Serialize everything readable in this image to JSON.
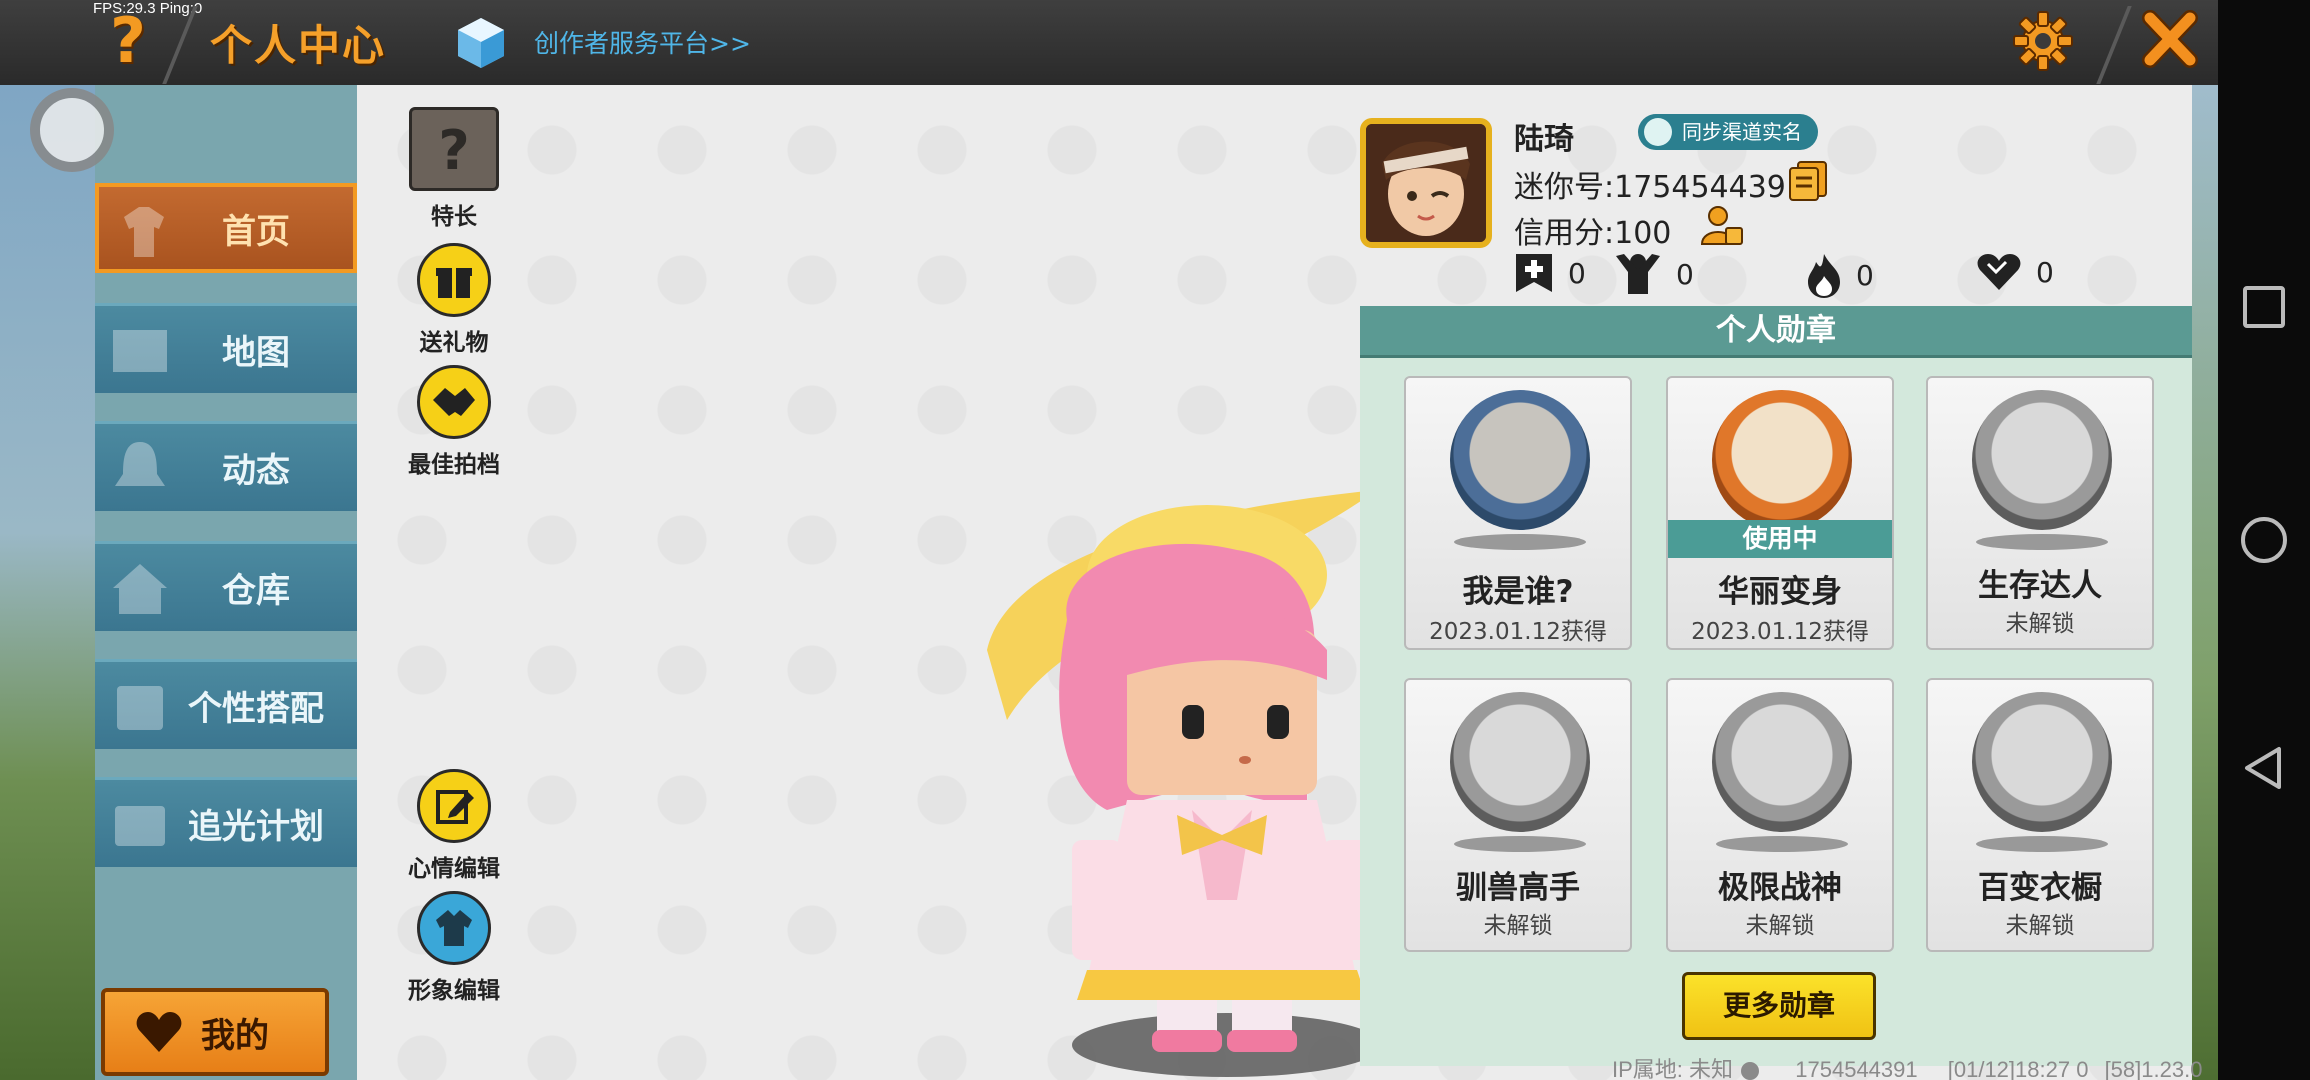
{
  "top_bar": {
    "fps": "FPS:29.3  Ping:0",
    "title": "个人中心",
    "creator_link": "创作者服务平台>>"
  },
  "sidebar": {
    "items": [
      {
        "label": "首页",
        "active": true
      },
      {
        "label": "地图"
      },
      {
        "label": "动态"
      },
      {
        "label": "仓库"
      },
      {
        "label": "个性搭配"
      },
      {
        "label": "追光计划"
      }
    ],
    "mine_label": "我的"
  },
  "tools": [
    {
      "label": "特长",
      "icon": "question-box-icon"
    },
    {
      "label": "送礼物",
      "icon": "gift-icon"
    },
    {
      "label": "最佳拍档",
      "icon": "handshake-icon"
    },
    {
      "label": "心情编辑",
      "icon": "edit-icon"
    },
    {
      "label": "形象编辑",
      "icon": "outfit-icon"
    }
  ],
  "profile": {
    "nickname": "陆琦",
    "sync_badge": "同步渠道实名",
    "mini_id": "迷你号:1754544391",
    "credit": "信用分:100",
    "stats": [
      {
        "icon": "add-friend-icon",
        "value": "0"
      },
      {
        "icon": "fans-icon",
        "value": "0"
      },
      {
        "icon": "fire-icon",
        "value": "0"
      },
      {
        "icon": "likes-icon",
        "value": "0"
      }
    ]
  },
  "medals": {
    "header": "个人勋章",
    "items": [
      {
        "name": "我是谁?",
        "sub": "2023.01.12获得",
        "style": "blue"
      },
      {
        "name": "华丽变身",
        "sub": "2023.01.12获得",
        "style": "orange",
        "badge": "使用中"
      },
      {
        "name": "生存达人",
        "sub": "未解锁",
        "style": "gray"
      },
      {
        "name": "驯兽高手",
        "sub": "未解锁",
        "style": "gray"
      },
      {
        "name": "极限战神",
        "sub": "未解锁",
        "style": "gray"
      },
      {
        "name": "百变衣橱",
        "sub": "未解锁",
        "style": "gray"
      }
    ],
    "more_button": "更多勋章"
  },
  "footer": {
    "ip": "IP属地: 未知",
    "uid": "1754544391",
    "time": "[01/12]18:27 0",
    "version": "[58]1.23.0"
  },
  "colors": {
    "accent_orange": "#f39a22",
    "sidebar_blue": "#3b7690",
    "medal_teal": "#5b9a93",
    "button_yellow": "#f0c214"
  }
}
